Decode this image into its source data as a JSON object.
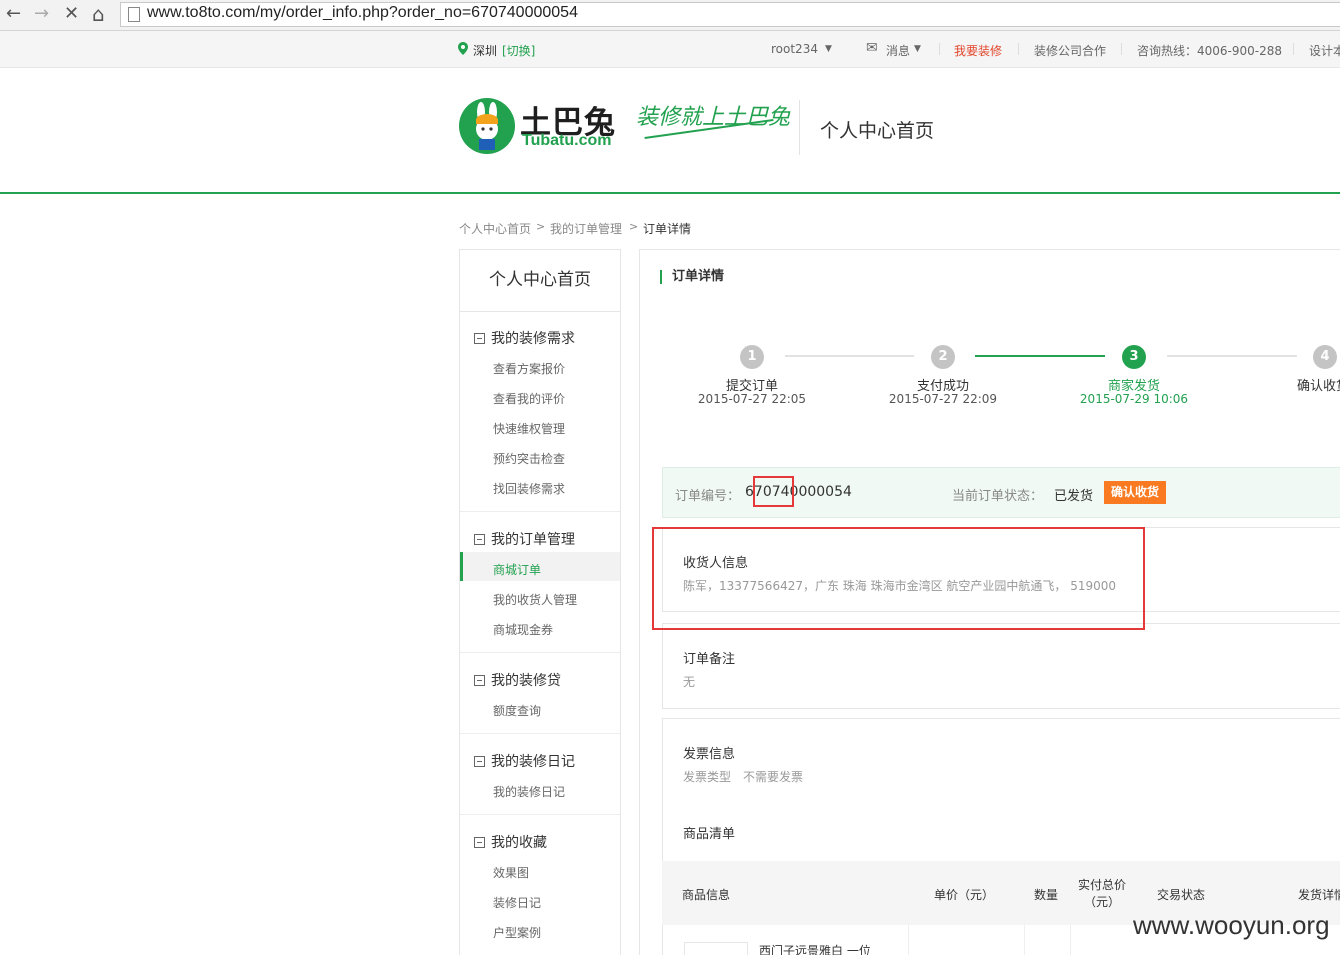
{
  "browser": {
    "back": "←",
    "forward": "→",
    "stop": "✕",
    "home": "⌂",
    "url": "www.to8to.com/my/order_info.php?order_no=670740000054"
  },
  "topbar": {
    "city": "深圳",
    "switch": "[切换]",
    "user": "root234",
    "messages": "消息",
    "renovate": "我要装修",
    "partner": "装修公司合作",
    "hotline": "咨询热线：4006-900-288",
    "designer": "设计本"
  },
  "header": {
    "brand_cn": "土巴兔",
    "brand_en": "Tubatu.com",
    "slogan": "装修就上土巴兔",
    "title": "个人中心首页"
  },
  "breadcrumb": [
    "个人中心首页",
    "我的订单管理",
    "订单详情"
  ],
  "sidebar": {
    "title": "个人中心首页",
    "groups": [
      {
        "label": "我的装修需求",
        "items": [
          "查看方案报价",
          "查看我的评价",
          "快速维权管理",
          "预约突击检查",
          "找回装修需求"
        ]
      },
      {
        "label": "我的订单管理",
        "items": [
          "商城订单",
          "我的收货人管理",
          "商城现金券"
        ]
      },
      {
        "label": "我的装修贷",
        "items": [
          "额度查询"
        ]
      },
      {
        "label": "我的装修日记",
        "items": [
          "我的装修日记"
        ]
      },
      {
        "label": "我的收藏",
        "items": [
          "效果图",
          "装修日记",
          "户型案例"
        ]
      }
    ]
  },
  "main": {
    "title": "订单详情",
    "steps": [
      {
        "num": "1",
        "label": "提交订单",
        "date": "2015-07-27 22:05"
      },
      {
        "num": "2",
        "label": "支付成功",
        "date": "2015-07-27 22:09"
      },
      {
        "num": "3",
        "label": "商家发货",
        "date": "2015-07-29 10:06"
      },
      {
        "num": "4",
        "label": "确认收货",
        "date": ""
      }
    ],
    "current_step": 3,
    "order": {
      "no_label": "订单编号：",
      "no": "670740000054",
      "status_label": "当前订单状态：",
      "status": "已发货",
      "confirm": "确认收货"
    },
    "receiver": {
      "title": "收货人信息",
      "text": "陈军，13377566427，广东 珠海 珠海市金湾区 航空产业园中航通飞， 519000"
    },
    "remark": {
      "title": "订单备注",
      "text": "无"
    },
    "invoice": {
      "title": "发票信息",
      "type_label": "发票类型",
      "type_value": "不需要发票"
    },
    "goods": {
      "title": "商品清单",
      "columns": [
        "商品信息",
        "单价（元）",
        "数量",
        "实付总价\n（元）",
        "交易状态",
        "发货详情"
      ],
      "first_item": "西门子远景雅白 一位"
    }
  },
  "watermark": "www.wooyun.org",
  "colors": {
    "brand": "#22a14f",
    "accent": "#f97a20",
    "highlight": "#e53939",
    "inactive": "#c4c4c4"
  }
}
